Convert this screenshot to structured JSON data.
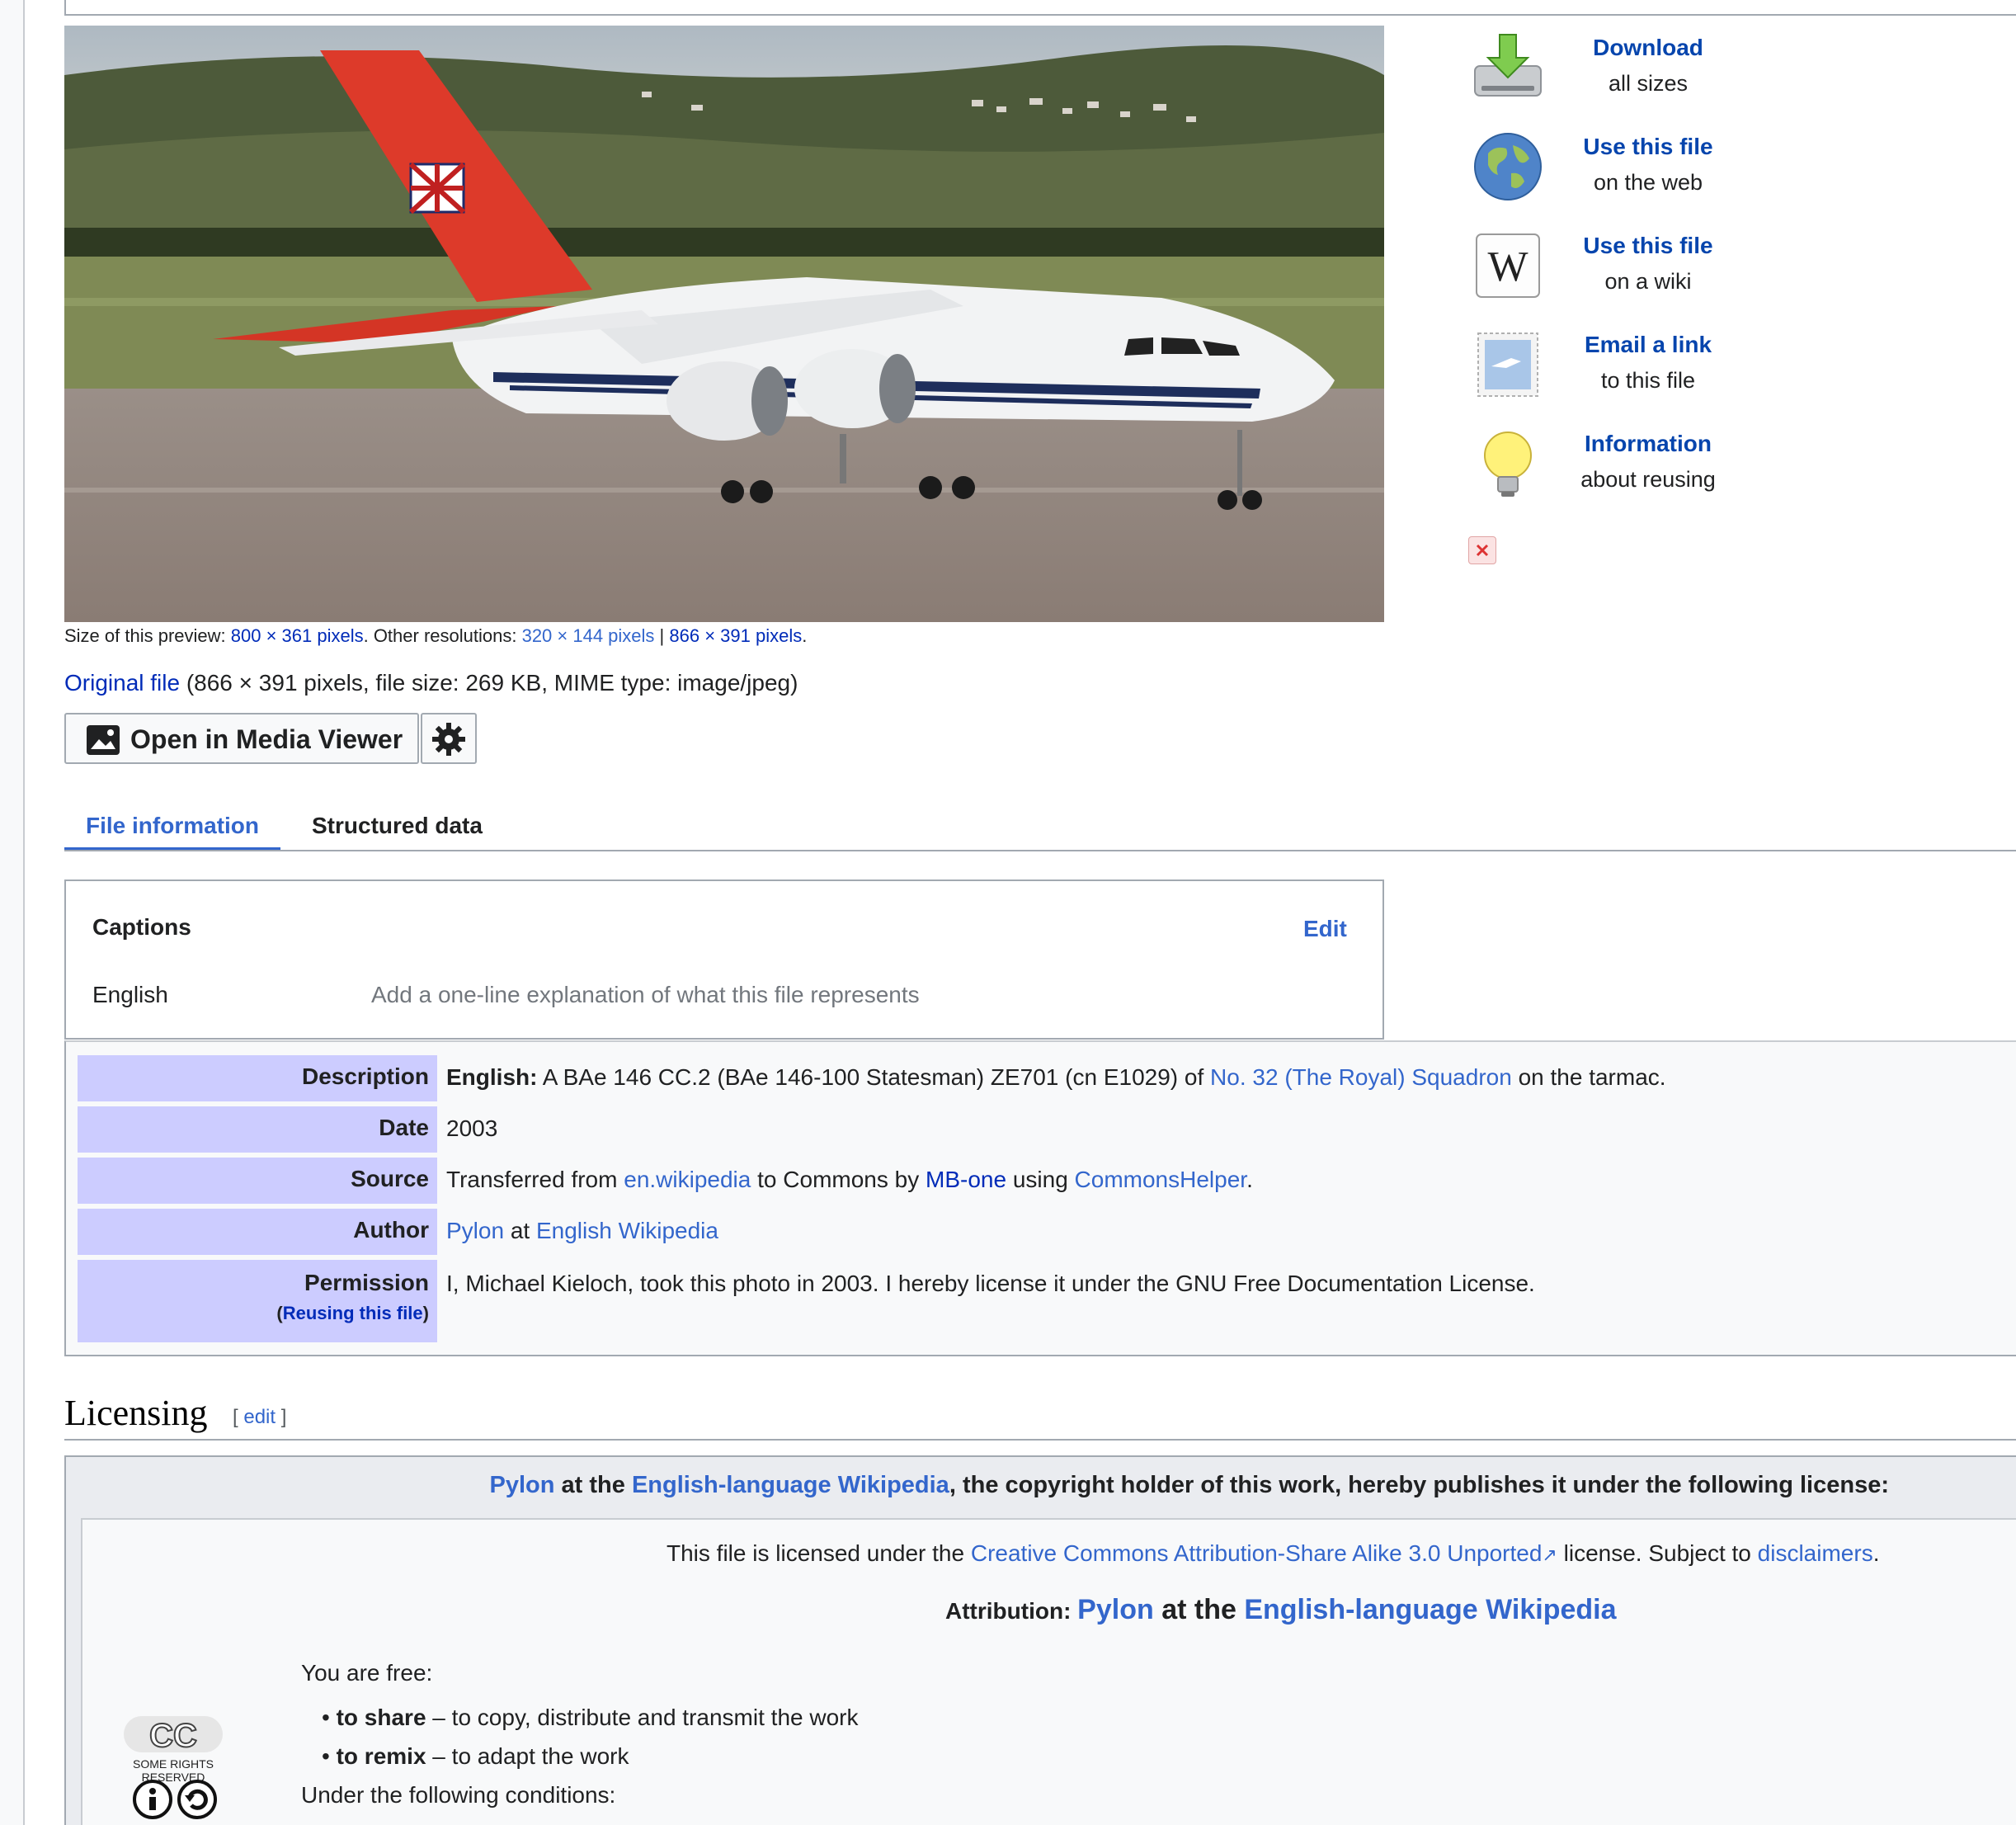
{
  "preview": {
    "size_prefix": "Size of this preview: ",
    "size_link": "800 × 361 pixels",
    "other_prefix": ". Other resolutions: ",
    "res_small": "320 × 144 pixels",
    "res_sep": " | ",
    "res_full": "866 × 391 pixels",
    "res_end": "."
  },
  "original": {
    "link": "Original file",
    "details": " (866 × 391 pixels, file size: 269 KB, MIME type: image/jpeg)"
  },
  "actions": [
    {
      "title": "Download",
      "sub": "all sizes",
      "icon": "download-icon"
    },
    {
      "title": "Use this file",
      "sub": "on the web",
      "icon": "globe-icon"
    },
    {
      "title": "Use this file",
      "sub": "on a wiki",
      "icon": "wikipedia-icon"
    },
    {
      "title": "Email a link",
      "sub": "to this file",
      "icon": "stamp-icon"
    },
    {
      "title": "Information",
      "sub": "about reusing",
      "icon": "lightbulb-icon"
    }
  ],
  "media_viewer": {
    "label": "Open in Media Viewer"
  },
  "tabs": {
    "file_info": "File information",
    "structured": "Structured data"
  },
  "captions": {
    "title": "Captions",
    "edit": "Edit",
    "lang": "English",
    "placeholder": "Add a one-line explanation of what this file represents"
  },
  "info": {
    "description_key": "Description",
    "description_lang": "English:",
    "description_text": " A BAe 146 CC.2 (BAe 146-100 Statesman) ZE701 (cn E1029) of ",
    "description_link": "No. 32 (The Royal) Squadron",
    "description_end": " on the tarmac.",
    "date_key": "Date",
    "date_value": "2003",
    "source_key": "Source",
    "source_pre": "Transferred from ",
    "source_link1": "en.wikipedia",
    "source_mid": " to Commons by ",
    "source_link2": "MB-one",
    "source_mid2": " using ",
    "source_link3": "CommonsHelper",
    "source_end": ".",
    "author_key": "Author",
    "author_link1": "Pylon",
    "author_mid": " at ",
    "author_link2": "English Wikipedia",
    "permission_key": "Permission",
    "permission_open": "(",
    "permission_sub": "Reusing this file",
    "permission_close": ")",
    "permission_value": "I, Michael Kieloch, took this photo in 2003. I hereby license it under the GNU Free Documentation License."
  },
  "licensing": {
    "heading": "Licensing",
    "edit_open": "[ ",
    "edit": "edit",
    "edit_close": " ]",
    "intro_link1": "Pylon",
    "intro_mid": " at the ",
    "intro_link2": "English-language Wikipedia",
    "intro_end": ", the copyright holder of this work, hereby publishes it under the following license:",
    "text_pre": "This file is licensed under the ",
    "text_link": "Creative Commons Attribution-Share Alike 3.0 Unported",
    "text_mid": " license. Subject to ",
    "text_link2": "disclaimers",
    "text_end": ".",
    "attr_label": "Attribution: ",
    "attr_link1": "Pylon",
    "attr_mid": " at the ",
    "attr_link2": "English-language Wikipedia",
    "free": "You are free:",
    "share_bold": "to share",
    "share_text": " – to copy, distribute and transmit the work",
    "remix_bold": "to remix",
    "remix_text": " – to adapt the work",
    "conditions": "Under the following conditions:",
    "cc_mark": "CC",
    "cc_caption": "SOME RIGHTS RESERVED"
  },
  "colors": {
    "link": "#3366cc",
    "label_bg": "#ccccff",
    "table_bg": "#f8f9fa"
  }
}
